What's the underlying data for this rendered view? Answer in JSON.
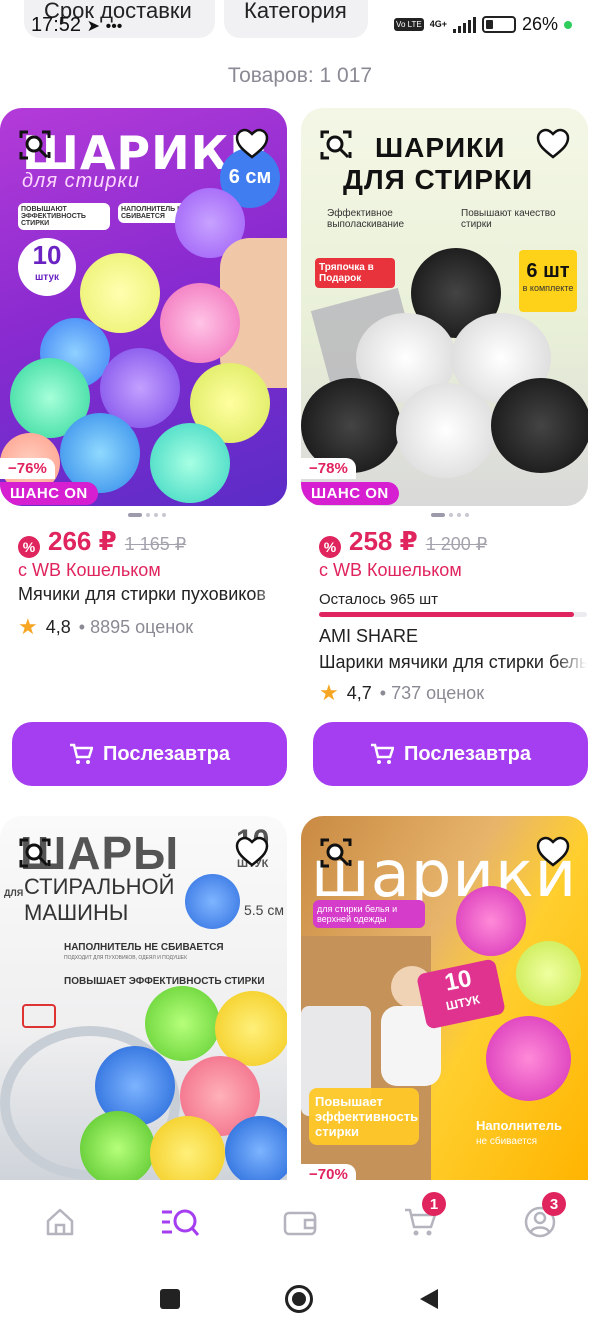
{
  "status_bar": {
    "time": "17:52",
    "network": "4G+",
    "volte": "Vo LTE",
    "battery": "26%"
  },
  "filters": {
    "delivery": "Срок доставки",
    "category": "Категория"
  },
  "items_count": "Товаров: 1 017",
  "products": [
    {
      "image": {
        "headline": "ШАРИКИ",
        "subline": "для стирки",
        "size": "6 см",
        "count_num": "10",
        "count_word": "штук",
        "feature1": "ПОВЫШАЮТ ЭФФЕКТИВНОСТЬ СТИРКИ",
        "feature2": "НАПОЛНИТЕЛЬ НЕ СБИВАЕТСЯ"
      },
      "discount": "−76%",
      "promo": "ШАНС ON",
      "price": "266 ₽",
      "old_price": "1 165 ₽",
      "wallet": "с WB Кошельком",
      "title": "Мячики для стирки пуховиков",
      "rating": "4,8",
      "reviews": "8895 оценок",
      "button": "Послезавтра"
    },
    {
      "image": {
        "headline1": "ШАРИКИ",
        "headline2": "ДЛЯ СТИРКИ",
        "feat1": "Эффективное выполаскивание",
        "feat2": "Повышают качество стирки",
        "gift": "Тряпочка в Подарок",
        "count": "6 шт",
        "count_sub": "в комплекте"
      },
      "discount": "−78%",
      "promo": "ШАНС ON",
      "price": "258 ₽",
      "old_price": "1 200 ₽",
      "wallet": "с WB Кошельком",
      "stock": "Осталось 965 шт",
      "stock_level": 0.95,
      "brand": "AMI SHARE",
      "title": "Шарики мячики для стирки белья",
      "rating": "4,7",
      "reviews": "737 оценок",
      "button": "Послезавтра"
    },
    {
      "image": {
        "headline": "ШАРЫ",
        "sub_prefix": "ДЛЯ",
        "line1": "СТИРАЛЬНОЙ",
        "line2": "МАШИНЫ",
        "size": "5.5 см",
        "count_num": "10",
        "count_word": "ШТУК",
        "feat1": "НАПОЛНИТЕЛЬ НЕ СБИВАЕТСЯ",
        "feat1_sub": "ПОДХОДИТ ДЛЯ ПУХОВИКОВ, ОДЕЯЛ И ПОДУШЕК",
        "feat2": "ПОВЫШАЕТ ЭФФЕКТИВНОСТЬ СТИРКИ"
      }
    },
    {
      "image": {
        "headline": "шарики",
        "tag": "для стирки белья и верхней одежды",
        "count_num": "10",
        "count_word": "ШТУК",
        "feat1": "Повышает эффективность стирки",
        "feat2": "Наполнитель",
        "feat2_sub": "не сбивается"
      },
      "discount": "−70%"
    }
  ],
  "bottom_nav": {
    "cart_badge": "1",
    "profile_badge": "3"
  }
}
